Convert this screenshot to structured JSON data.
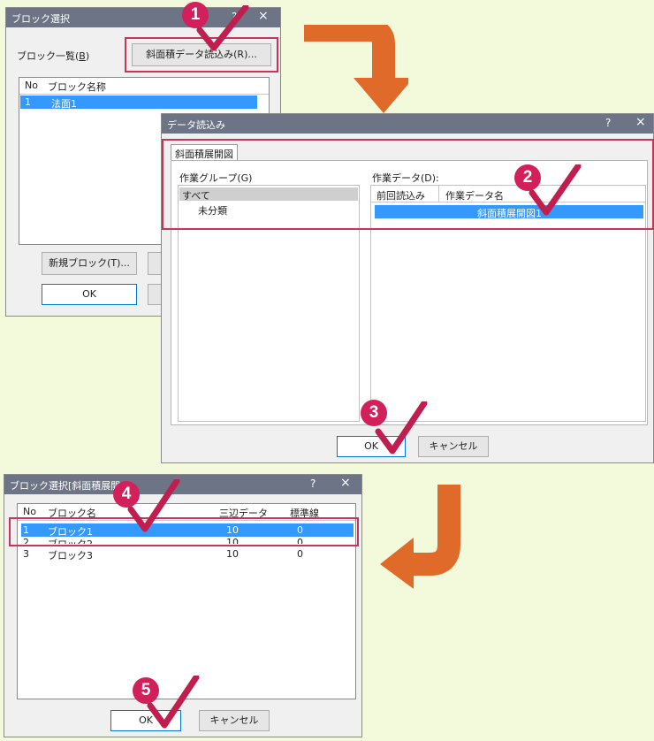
{
  "colors": {
    "accent": "#d2205a",
    "selection": "#3399ff",
    "arrow": "#e06a2a",
    "highlight_box": "#c9345a"
  },
  "dialog1": {
    "title": "ブロック選択",
    "help": "?",
    "close": "×",
    "block_list_label": "ブロック一覧(",
    "block_list_key": "B",
    "block_list_end": ")",
    "import_button": "斜面積データ読込み(R)...",
    "col_no": "No",
    "col_name": "ブロック名称",
    "rows": [
      {
        "no": "1",
        "name": "法面1"
      }
    ],
    "new_block_button": "新規ブロック(T)...",
    "ok_button": "OK"
  },
  "dialog2": {
    "title": "データ読込み",
    "help": "?",
    "close": "×",
    "tab": "斜面積展開図",
    "group_label": "作業グループ(G)",
    "groups": [
      "すべて",
      "未分類"
    ],
    "data_label": "作業データ(D):",
    "col_prev": "前回読込み",
    "col_name": "作業データ名",
    "rows": [
      {
        "name": "斜面積展開図1"
      }
    ],
    "ok_button": "OK",
    "cancel_button": "キャンセル"
  },
  "dialog3": {
    "title": "ブロック選択[斜面積展開",
    "help": "?",
    "close": "×",
    "col_no": "No",
    "col_name": "ブロック名",
    "col_3d": "三辺データ",
    "col_std": "標準線",
    "rows": [
      {
        "no": "1",
        "name": "ブロック1",
        "d3": "10",
        "std": "0"
      },
      {
        "no": "2",
        "name": "ブロック2",
        "d3": "10",
        "std": "0"
      },
      {
        "no": "3",
        "name": "ブロック3",
        "d3": "10",
        "std": "0"
      }
    ],
    "ok_button": "OK",
    "cancel_button": "キャンセル"
  },
  "steps": [
    "1",
    "2",
    "3",
    "4",
    "5"
  ]
}
